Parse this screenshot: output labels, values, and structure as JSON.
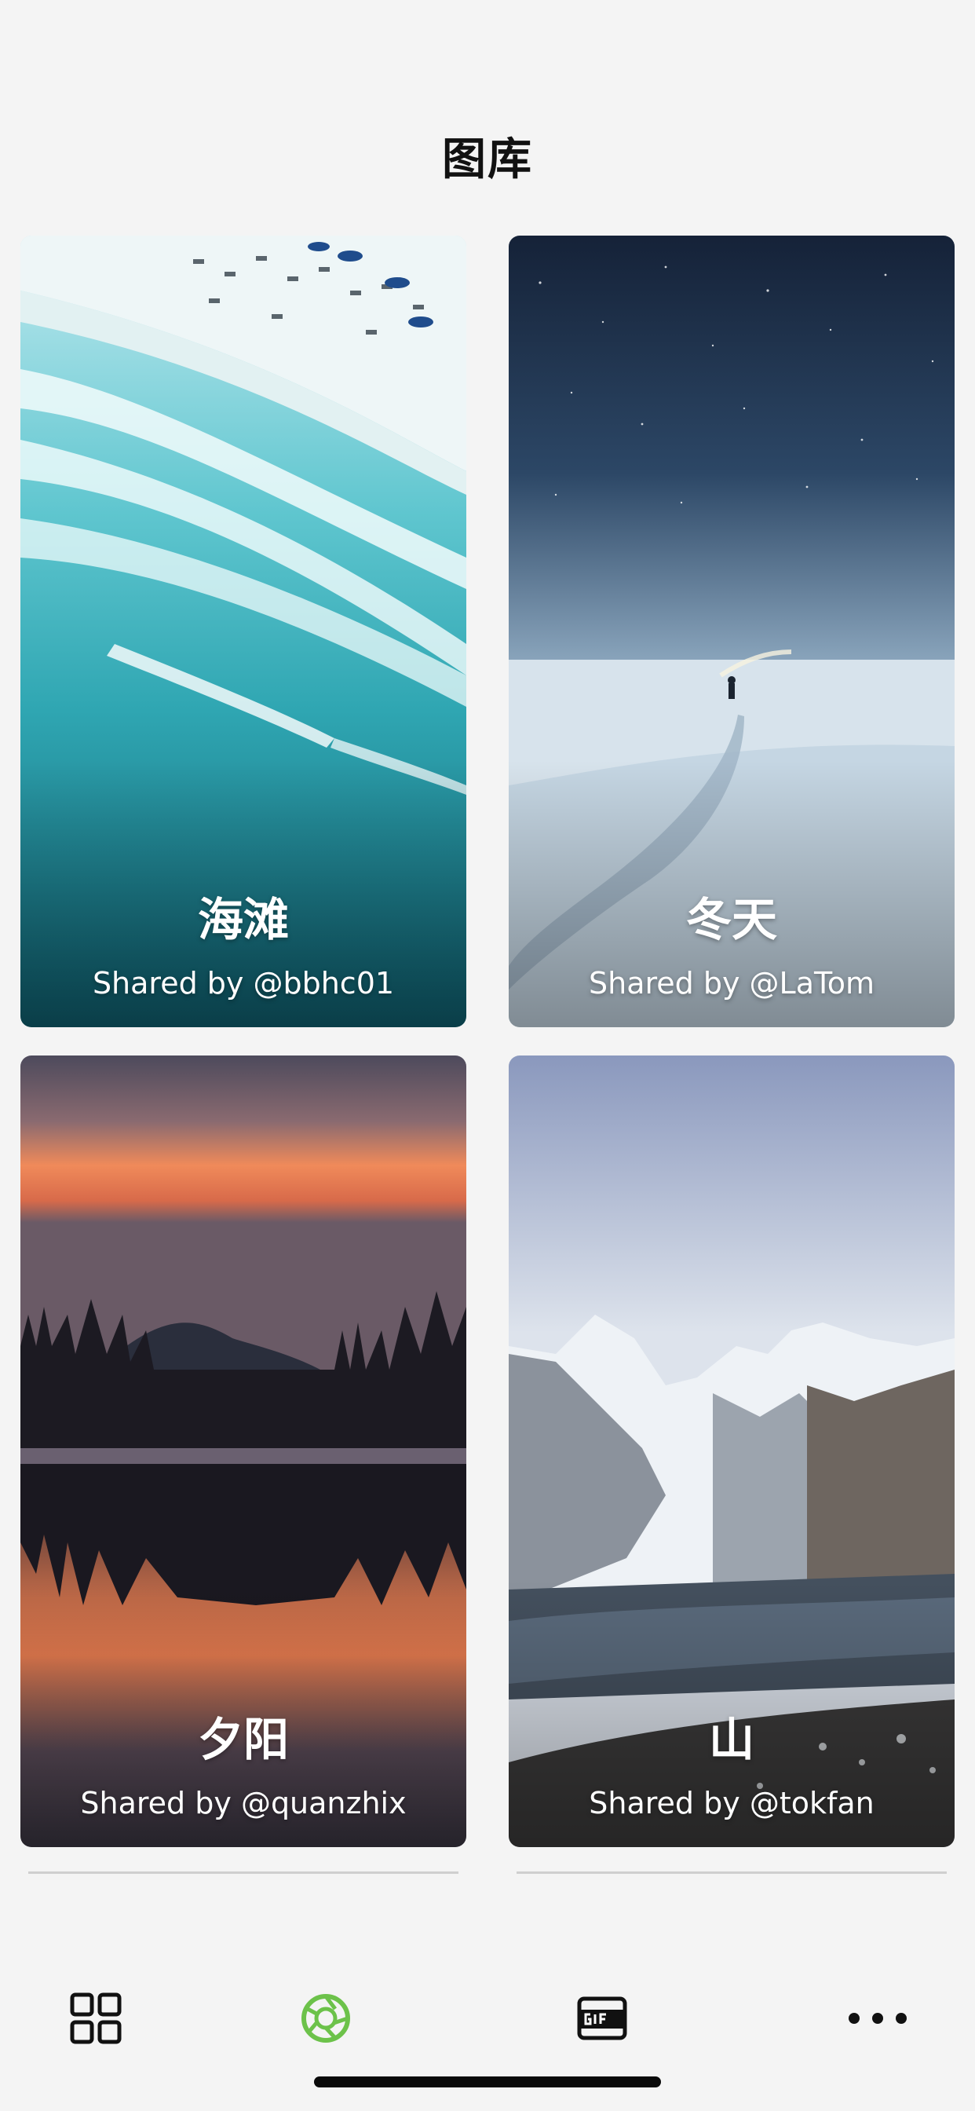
{
  "header": {
    "title": "图库"
  },
  "cards": [
    {
      "title": "海滩",
      "credit": "Shared by @bbhc01",
      "image": "beach-aerial-photo"
    },
    {
      "title": "冬天",
      "credit": "Shared by @LaTom",
      "image": "winter-night-snowfield-photo"
    },
    {
      "title": "夕阳",
      "credit": "Shared by @quanzhix",
      "image": "sunset-lake-mountain-photo"
    },
    {
      "title": "山",
      "credit": "Shared by @tokfan",
      "image": "snowy-mountain-lake-photo"
    }
  ],
  "tabbar": {
    "items": [
      {
        "icon": "grid-icon",
        "active": false
      },
      {
        "icon": "aperture-icon",
        "active": true
      },
      {
        "icon": "gif-icon",
        "active": false
      },
      {
        "icon": "more-dots-icon",
        "active": false
      }
    ],
    "active_color": "#6cc24a"
  }
}
